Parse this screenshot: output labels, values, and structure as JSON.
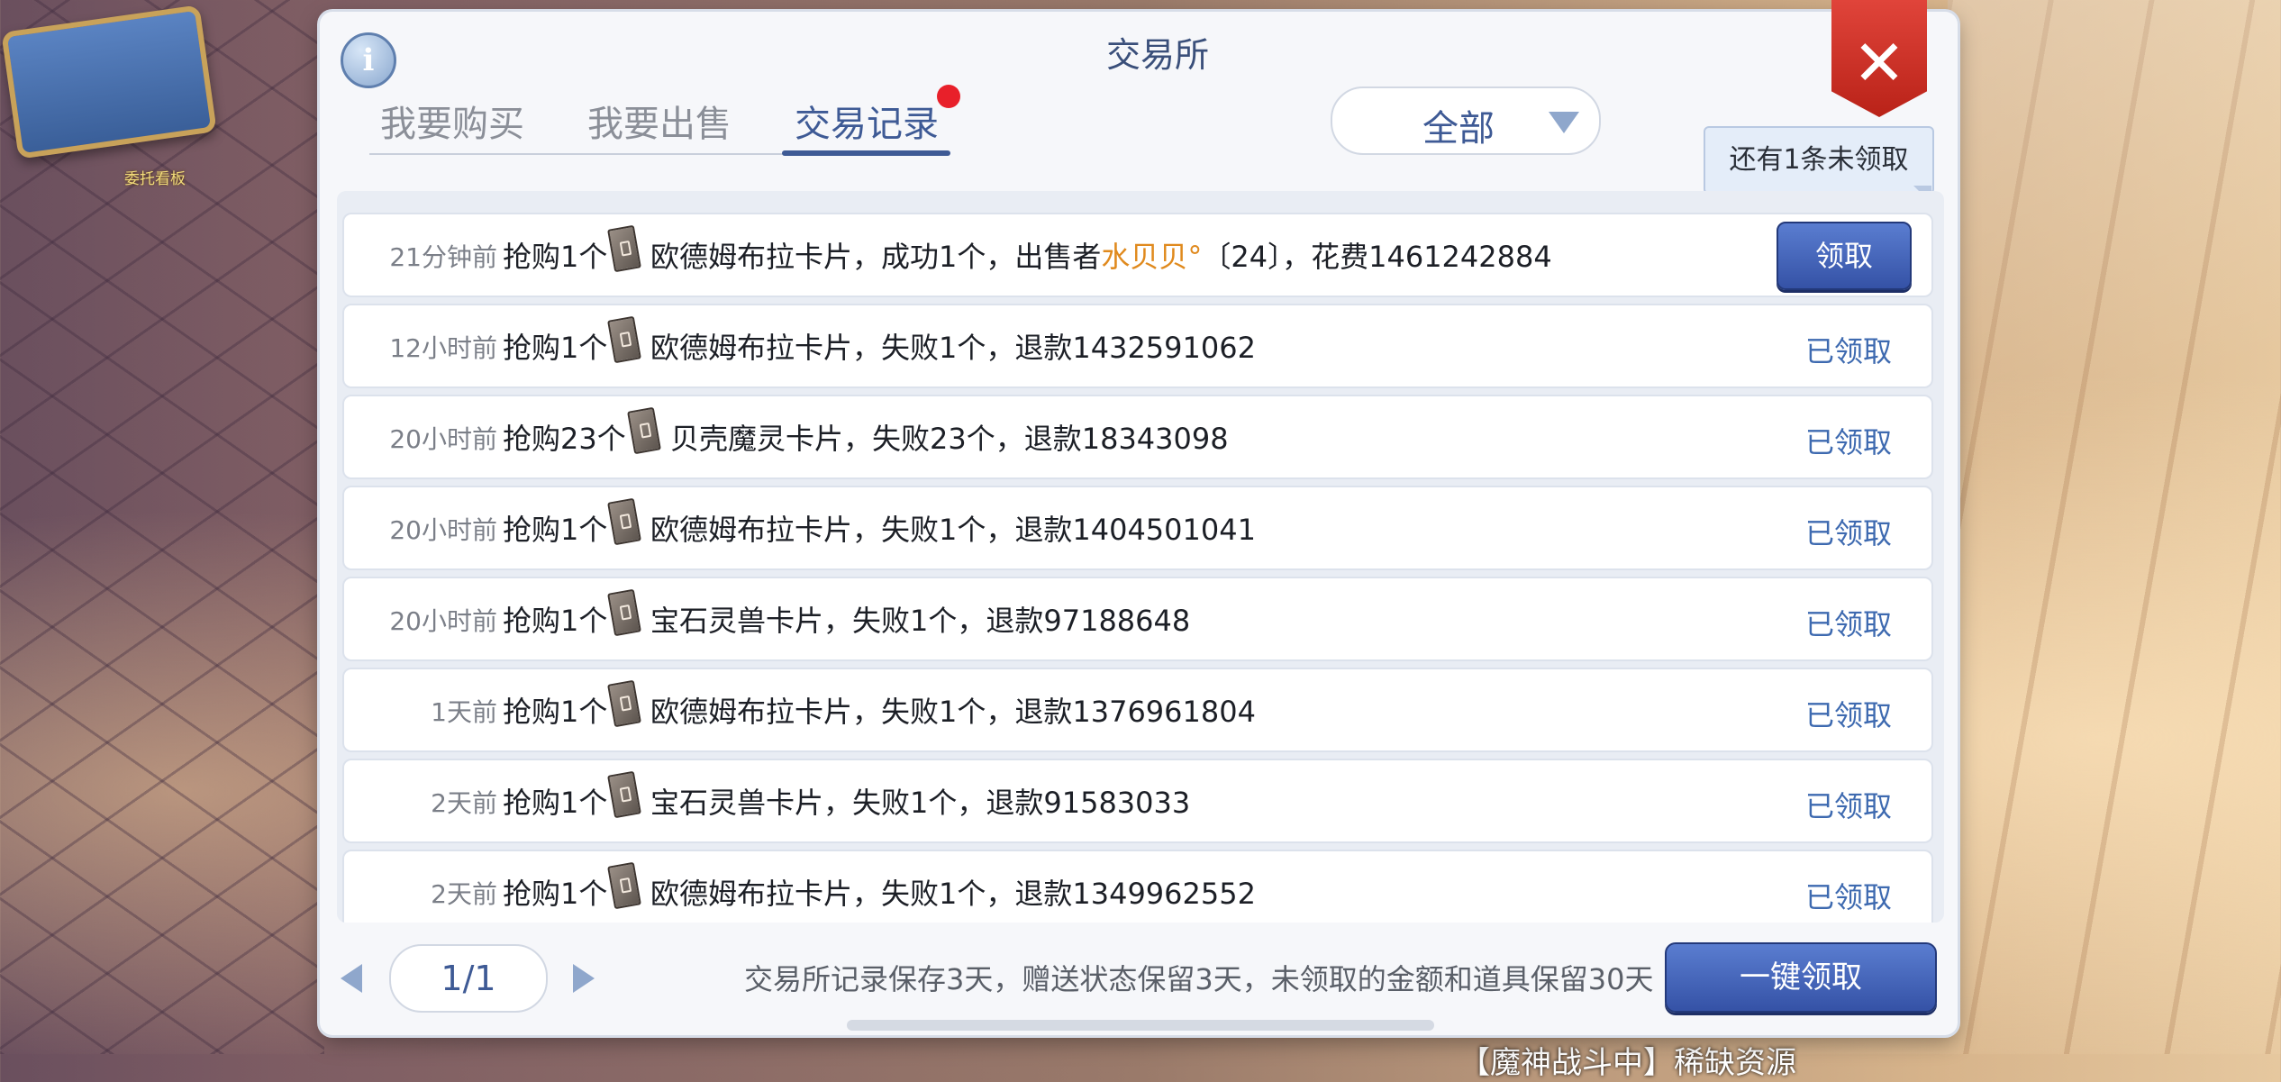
{
  "background": {
    "board_label": "委托看板",
    "bottom_text": "【魔神战斗中】稀缺资源"
  },
  "dialog": {
    "title": "交易所",
    "tabs": [
      {
        "label": "我要购买"
      },
      {
        "label": "我要出售"
      },
      {
        "label": "交易记录"
      }
    ],
    "active_tab": 2,
    "filter": {
      "selected": "全部"
    },
    "tooltip": "还有1条未领取",
    "records": [
      {
        "time": "21分钟前",
        "action": "抢购1个",
        "pre": "欧德姆布拉卡片，成功1个，出售者",
        "seller": "水贝贝°",
        "post": "〔24〕，花费1461242884",
        "status": "领取",
        "claimable": true
      },
      {
        "time": "12小时前",
        "action": "抢购1个",
        "pre": "欧德姆布拉卡片，失败1个，退款1432591062",
        "seller": "",
        "post": "",
        "status": "已领取",
        "claimable": false
      },
      {
        "time": "20小时前",
        "action": "抢购23个",
        "pre": "贝壳魔灵卡片，失败23个，退款18343098",
        "seller": "",
        "post": "",
        "status": "已领取",
        "claimable": false
      },
      {
        "time": "20小时前",
        "action": "抢购1个",
        "pre": "欧德姆布拉卡片，失败1个，退款1404501041",
        "seller": "",
        "post": "",
        "status": "已领取",
        "claimable": false
      },
      {
        "time": "20小时前",
        "action": "抢购1个",
        "pre": "宝石灵兽卡片，失败1个，退款97188648",
        "seller": "",
        "post": "",
        "status": "已领取",
        "claimable": false
      },
      {
        "time": "1天前",
        "action": "抢购1个",
        "pre": "欧德姆布拉卡片，失败1个，退款1376961804",
        "seller": "",
        "post": "",
        "status": "已领取",
        "claimable": false
      },
      {
        "time": "2天前",
        "action": "抢购1个",
        "pre": "宝石灵兽卡片，失败1个，退款91583033",
        "seller": "",
        "post": "",
        "status": "已领取",
        "claimable": false
      },
      {
        "time": "2天前",
        "action": "抢购1个",
        "pre": "欧德姆布拉卡片，失败1个，退款1349962552",
        "seller": "",
        "post": "",
        "status": "已领取",
        "claimable": false
      }
    ],
    "pagination": {
      "page": "1/1"
    },
    "footer_note": "交易所记录保存3天，赠送状态保留3天，未领取的金额和道具保留30天",
    "claim_all_label": "一键领取"
  },
  "colors": {
    "accent": "#3e5a95",
    "seller": "#e08a1e",
    "close": "#d63a2e",
    "badge": "#e8202a"
  }
}
